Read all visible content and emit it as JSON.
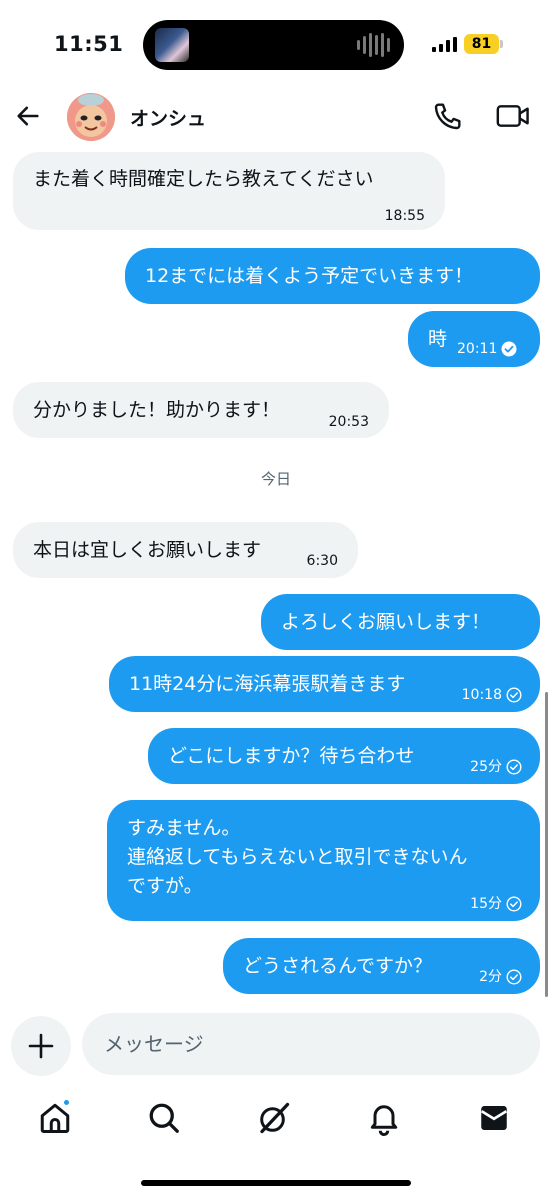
{
  "status_bar": {
    "time": "11:51",
    "battery": "81"
  },
  "header": {
    "contact_name": "オンシュ"
  },
  "messages": [
    {
      "direction": "in",
      "text": "また着く時間確定したら教えてください",
      "time": "18:55"
    },
    {
      "direction": "out",
      "text": "12までには着くよう予定でいきます！",
      "time": ""
    },
    {
      "direction": "out",
      "text": "時",
      "time": "20:11",
      "read": true
    },
    {
      "direction": "in",
      "text": "分かりました！助かります！",
      "time": "20:53"
    },
    {
      "direction": "in",
      "text": "本日は宜しくお願いします",
      "time": "6:30"
    },
    {
      "direction": "out",
      "text": "よろしくお願いします！",
      "time": ""
    },
    {
      "direction": "out",
      "text": "11時24分に海浜幕張駅着きます",
      "time": "10:18",
      "read": true
    },
    {
      "direction": "out",
      "text": "どこにしますか？待ち合わせ",
      "time": "25分",
      "read": true
    },
    {
      "direction": "out",
      "text_lines": [
        "すみません。",
        "連絡返してもらえないと取引できないん",
        "ですが。"
      ],
      "time": "15分",
      "read": true
    },
    {
      "direction": "out",
      "text": "どうされるんですか？",
      "time": "2分",
      "read": true
    }
  ],
  "day_separator": "今日",
  "composer": {
    "placeholder": "メッセージ"
  },
  "tab_bar": {
    "tabs": [
      "home-icon",
      "search-icon",
      "grok-icon",
      "notifications-icon",
      "messages-icon"
    ],
    "notification_dot_color": "#1d9bf0"
  },
  "colors": {
    "accent": "#1d9bf0",
    "incoming_bubble": "#eff3f4",
    "text": "#0f1419",
    "muted": "#536471"
  }
}
